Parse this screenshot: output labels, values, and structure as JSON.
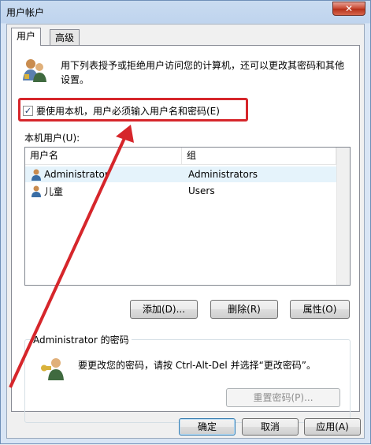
{
  "window": {
    "title": "用户帐户",
    "close_glyph": "✕"
  },
  "tabs": [
    {
      "label": "用户",
      "active": true
    },
    {
      "label": "高级",
      "active": false
    }
  ],
  "intro_text": "用下列表授予或拒绝用户访问您的计算机，还可以更改其密码和其他设置。",
  "require_password": {
    "checked": true,
    "check_glyph": "✓",
    "label": "要使用本机，用户必须输入用户名和密码(E)"
  },
  "local_users": {
    "label": "本机用户(U):",
    "columns": [
      "用户名",
      "组"
    ],
    "rows": [
      {
        "name": "Administrator",
        "group": "Administrators",
        "selected": true
      },
      {
        "name": "儿童",
        "group": "Users",
        "selected": false
      }
    ]
  },
  "user_buttons": {
    "add": "添加(D)...",
    "remove": "删除(R)",
    "properties": "属性(O)"
  },
  "password_group": {
    "title": "Administrator 的密码",
    "text": "要更改您的密码，请按 Ctrl-Alt-Del 并选择“更改密码”。",
    "reset_button": "重置密码(P)..."
  },
  "dialog_buttons": {
    "ok": "确定",
    "cancel": "取消",
    "apply": "应用(A)"
  },
  "colors": {
    "annotation_red": "#d6262b",
    "title_bar": "#c9dbf0"
  }
}
